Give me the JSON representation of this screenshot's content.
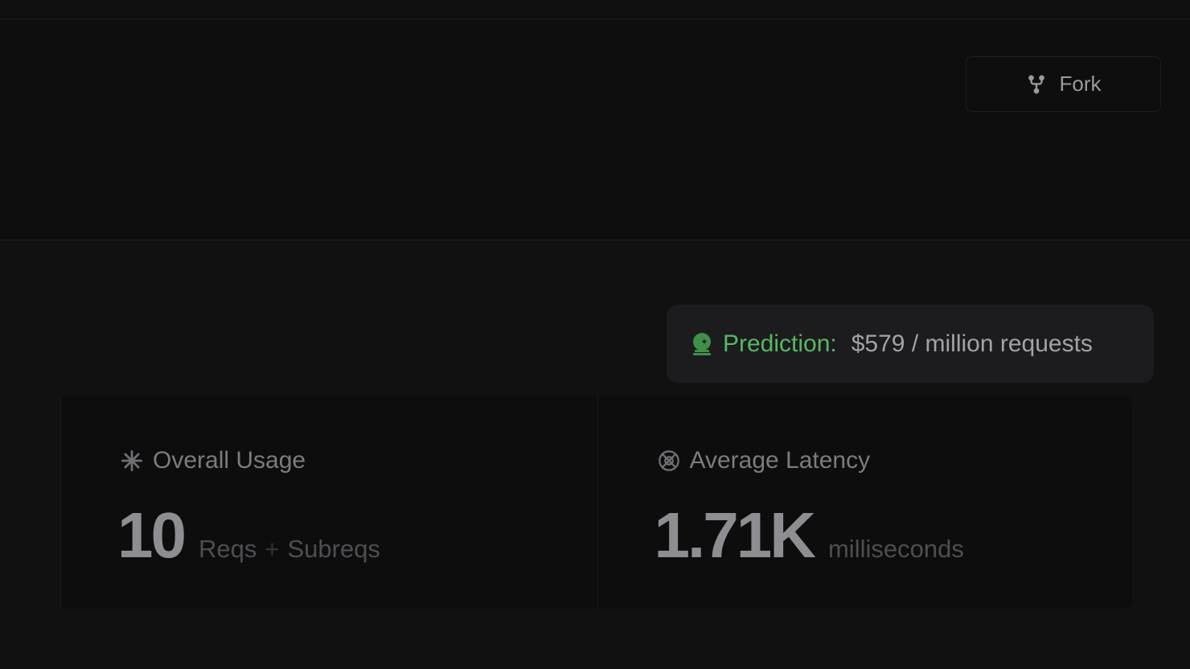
{
  "header": {
    "fork_label": "Fork"
  },
  "prediction": {
    "label": "Prediction:",
    "value": "$579 / million requests",
    "accent_color": "#57b863"
  },
  "stats": [
    {
      "title": "Overall Usage",
      "icon": "asterisk-icon",
      "value": "10",
      "unit_a": "Reqs",
      "unit_sep": "+",
      "unit_b": "Subreqs"
    },
    {
      "title": "Average Latency",
      "icon": "latency-icon",
      "value": "1.71K",
      "unit": "milliseconds"
    }
  ]
}
